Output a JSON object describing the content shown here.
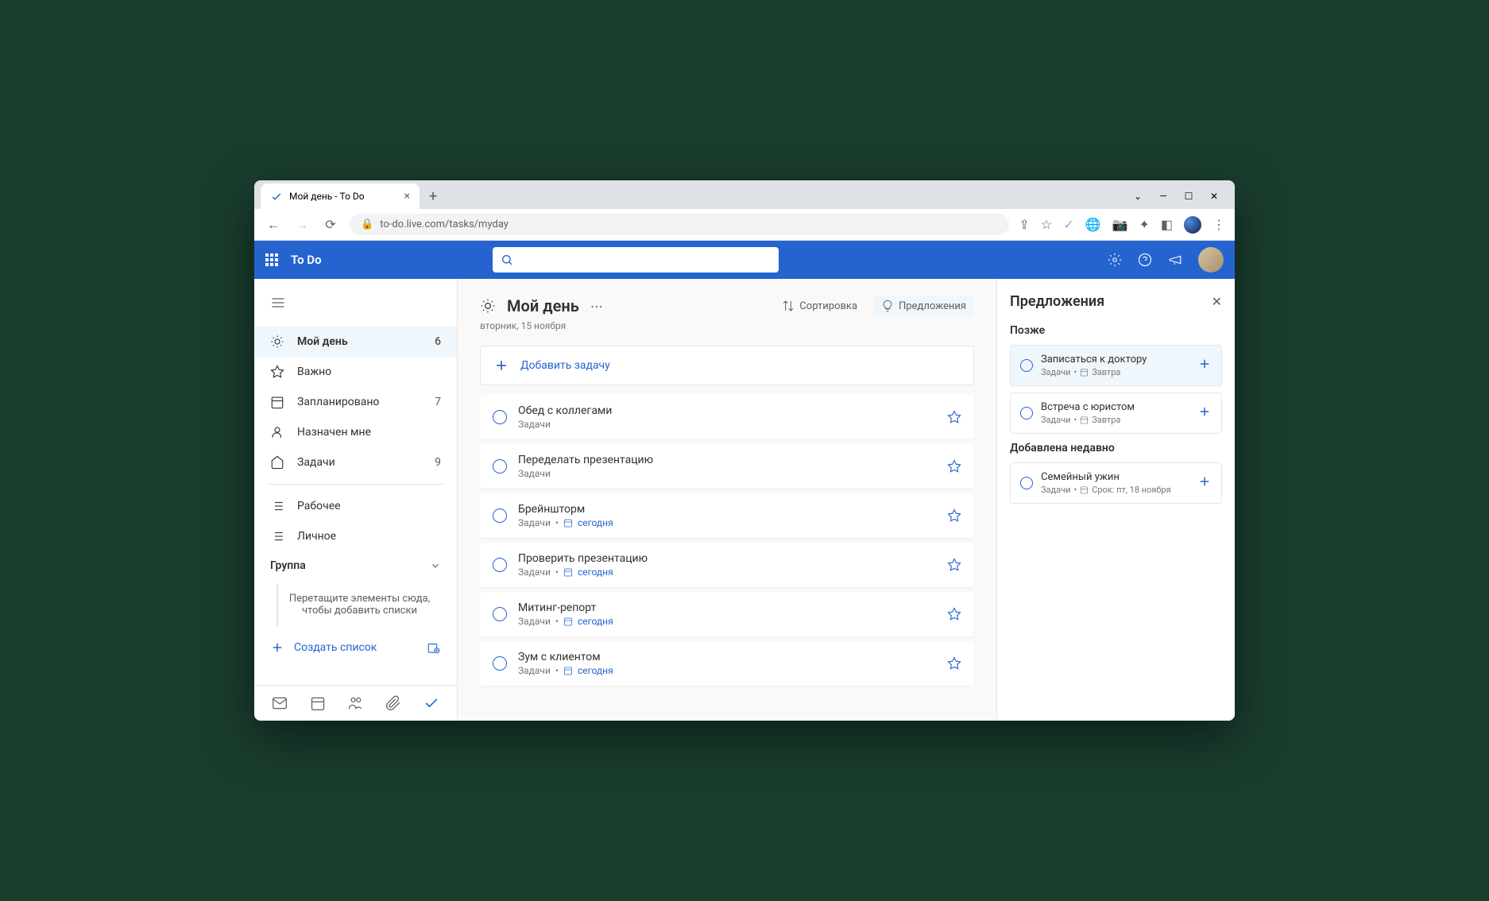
{
  "browser": {
    "tab_title": "Мой день - To Do",
    "url": "to-do.live.com/tasks/myday"
  },
  "app": {
    "title": "To Do"
  },
  "sidebar": {
    "items": [
      {
        "label": "Мой день",
        "count": "6"
      },
      {
        "label": "Важно",
        "count": ""
      },
      {
        "label": "Запланировано",
        "count": "7"
      },
      {
        "label": "Назначен мне",
        "count": ""
      },
      {
        "label": "Задачи",
        "count": "9"
      }
    ],
    "lists": [
      {
        "label": "Рабочее"
      },
      {
        "label": "Личное"
      }
    ],
    "group_label": "Группа",
    "group_drop_text": "Перетащите элементы сюда, чтобы добавить списки",
    "create_list_label": "Создать список"
  },
  "main": {
    "title": "Мой день",
    "date": "вторник, 15 ноября",
    "sort_label": "Сортировка",
    "suggestions_label": "Предложения",
    "add_task_label": "Добавить задачу",
    "tasks": [
      {
        "title": "Обед с коллегами",
        "list": "Задачи",
        "due": ""
      },
      {
        "title": "Переделать презентацию",
        "list": "Задачи",
        "due": ""
      },
      {
        "title": "Брейншторм",
        "list": "Задачи",
        "due": "сегодня"
      },
      {
        "title": "Проверить презентацию",
        "list": "Задачи",
        "due": "сегодня"
      },
      {
        "title": "Митинг-репорт",
        "list": "Задачи",
        "due": "сегодня"
      },
      {
        "title": "Зум с клиентом",
        "list": "Задачи",
        "due": "сегодня"
      }
    ]
  },
  "suggestions": {
    "title": "Предложения",
    "section_later": "Позже",
    "section_recent": "Добавлена недавно",
    "later": [
      {
        "title": "Записаться к доктору",
        "list": "Задачи",
        "due": "Завтра"
      },
      {
        "title": "Встреча с юристом",
        "list": "Задачи",
        "due": "Завтра"
      }
    ],
    "recent": [
      {
        "title": "Семейный ужин",
        "list": "Задачи",
        "due": "Срок: пт, 18 ноября"
      }
    ]
  }
}
